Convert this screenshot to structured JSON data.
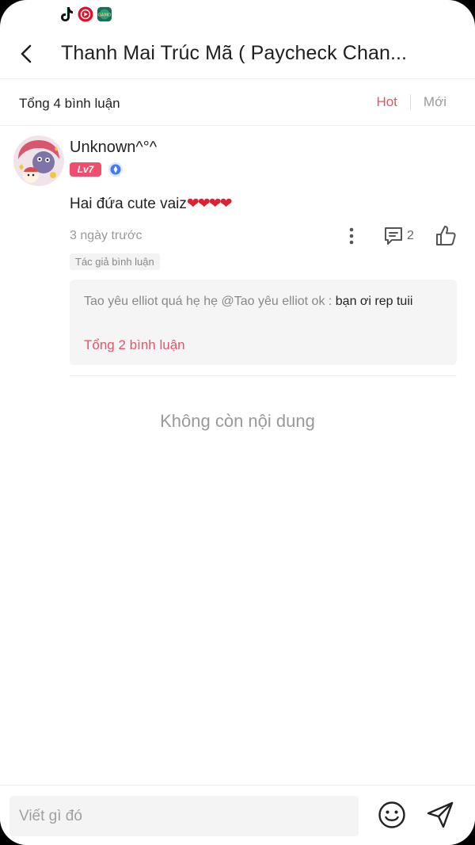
{
  "status_bar": {
    "icons": [
      "tiktok-icon",
      "youtube-music-icon",
      "game-app-icon"
    ],
    "game_icon_text": "GAMO"
  },
  "header": {
    "title": "Thanh Mai Trúc Mã ( Paycheck Chan..."
  },
  "tabs_bar": {
    "total_label": "Tổng 4 bình luận",
    "tabs": [
      {
        "label": "Hot",
        "active": true
      },
      {
        "label": "Mới",
        "active": false
      }
    ],
    "accent_color": "#e5546a"
  },
  "comment": {
    "username": "Unknown^°^",
    "level": "Lv7",
    "text": "Hai đứa cute vaiz",
    "hearts": "❤❤❤❤",
    "timestamp": "3 ngày trước",
    "reply_count": "2",
    "author_tag": "Tác giả bình luận",
    "replies": {
      "preview_prefix": "Tao yêu elliot quá hẹ hẹ @Tao yêu elliot ok : ",
      "preview_body": "bạn ơi rep tuii",
      "total_label": "Tổng 2 bình luận"
    }
  },
  "empty_state": "Không còn nội dung",
  "bottom_bar": {
    "input_placeholder": "Viết gì đó"
  }
}
